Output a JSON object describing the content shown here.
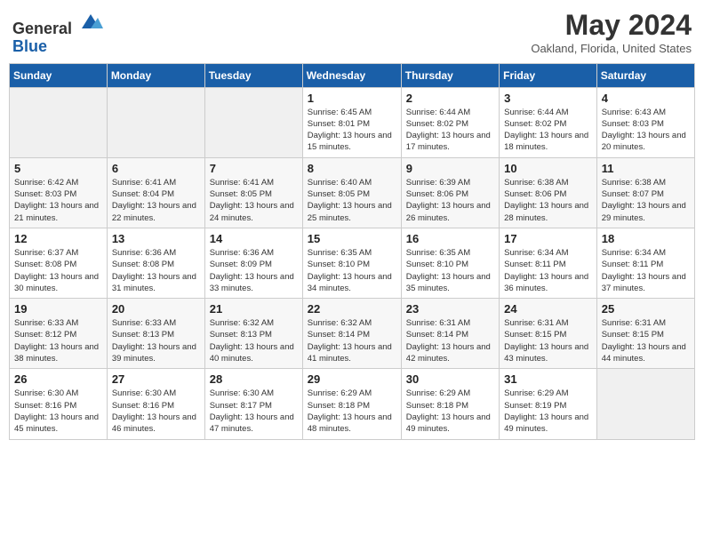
{
  "header": {
    "logo_line1": "General",
    "logo_line2": "Blue",
    "title": "May 2024",
    "location": "Oakland, Florida, United States"
  },
  "weekdays": [
    "Sunday",
    "Monday",
    "Tuesday",
    "Wednesday",
    "Thursday",
    "Friday",
    "Saturday"
  ],
  "weeks": [
    [
      {
        "day": "",
        "info": ""
      },
      {
        "day": "",
        "info": ""
      },
      {
        "day": "",
        "info": ""
      },
      {
        "day": "1",
        "info": "Sunrise: 6:45 AM\nSunset: 8:01 PM\nDaylight: 13 hours and 15 minutes."
      },
      {
        "day": "2",
        "info": "Sunrise: 6:44 AM\nSunset: 8:02 PM\nDaylight: 13 hours and 17 minutes."
      },
      {
        "day": "3",
        "info": "Sunrise: 6:44 AM\nSunset: 8:02 PM\nDaylight: 13 hours and 18 minutes."
      },
      {
        "day": "4",
        "info": "Sunrise: 6:43 AM\nSunset: 8:03 PM\nDaylight: 13 hours and 20 minutes."
      }
    ],
    [
      {
        "day": "5",
        "info": "Sunrise: 6:42 AM\nSunset: 8:03 PM\nDaylight: 13 hours and 21 minutes."
      },
      {
        "day": "6",
        "info": "Sunrise: 6:41 AM\nSunset: 8:04 PM\nDaylight: 13 hours and 22 minutes."
      },
      {
        "day": "7",
        "info": "Sunrise: 6:41 AM\nSunset: 8:05 PM\nDaylight: 13 hours and 24 minutes."
      },
      {
        "day": "8",
        "info": "Sunrise: 6:40 AM\nSunset: 8:05 PM\nDaylight: 13 hours and 25 minutes."
      },
      {
        "day": "9",
        "info": "Sunrise: 6:39 AM\nSunset: 8:06 PM\nDaylight: 13 hours and 26 minutes."
      },
      {
        "day": "10",
        "info": "Sunrise: 6:38 AM\nSunset: 8:06 PM\nDaylight: 13 hours and 28 minutes."
      },
      {
        "day": "11",
        "info": "Sunrise: 6:38 AM\nSunset: 8:07 PM\nDaylight: 13 hours and 29 minutes."
      }
    ],
    [
      {
        "day": "12",
        "info": "Sunrise: 6:37 AM\nSunset: 8:08 PM\nDaylight: 13 hours and 30 minutes."
      },
      {
        "day": "13",
        "info": "Sunrise: 6:36 AM\nSunset: 8:08 PM\nDaylight: 13 hours and 31 minutes."
      },
      {
        "day": "14",
        "info": "Sunrise: 6:36 AM\nSunset: 8:09 PM\nDaylight: 13 hours and 33 minutes."
      },
      {
        "day": "15",
        "info": "Sunrise: 6:35 AM\nSunset: 8:10 PM\nDaylight: 13 hours and 34 minutes."
      },
      {
        "day": "16",
        "info": "Sunrise: 6:35 AM\nSunset: 8:10 PM\nDaylight: 13 hours and 35 minutes."
      },
      {
        "day": "17",
        "info": "Sunrise: 6:34 AM\nSunset: 8:11 PM\nDaylight: 13 hours and 36 minutes."
      },
      {
        "day": "18",
        "info": "Sunrise: 6:34 AM\nSunset: 8:11 PM\nDaylight: 13 hours and 37 minutes."
      }
    ],
    [
      {
        "day": "19",
        "info": "Sunrise: 6:33 AM\nSunset: 8:12 PM\nDaylight: 13 hours and 38 minutes."
      },
      {
        "day": "20",
        "info": "Sunrise: 6:33 AM\nSunset: 8:13 PM\nDaylight: 13 hours and 39 minutes."
      },
      {
        "day": "21",
        "info": "Sunrise: 6:32 AM\nSunset: 8:13 PM\nDaylight: 13 hours and 40 minutes."
      },
      {
        "day": "22",
        "info": "Sunrise: 6:32 AM\nSunset: 8:14 PM\nDaylight: 13 hours and 41 minutes."
      },
      {
        "day": "23",
        "info": "Sunrise: 6:31 AM\nSunset: 8:14 PM\nDaylight: 13 hours and 42 minutes."
      },
      {
        "day": "24",
        "info": "Sunrise: 6:31 AM\nSunset: 8:15 PM\nDaylight: 13 hours and 43 minutes."
      },
      {
        "day": "25",
        "info": "Sunrise: 6:31 AM\nSunset: 8:15 PM\nDaylight: 13 hours and 44 minutes."
      }
    ],
    [
      {
        "day": "26",
        "info": "Sunrise: 6:30 AM\nSunset: 8:16 PM\nDaylight: 13 hours and 45 minutes."
      },
      {
        "day": "27",
        "info": "Sunrise: 6:30 AM\nSunset: 8:16 PM\nDaylight: 13 hours and 46 minutes."
      },
      {
        "day": "28",
        "info": "Sunrise: 6:30 AM\nSunset: 8:17 PM\nDaylight: 13 hours and 47 minutes."
      },
      {
        "day": "29",
        "info": "Sunrise: 6:29 AM\nSunset: 8:18 PM\nDaylight: 13 hours and 48 minutes."
      },
      {
        "day": "30",
        "info": "Sunrise: 6:29 AM\nSunset: 8:18 PM\nDaylight: 13 hours and 49 minutes."
      },
      {
        "day": "31",
        "info": "Sunrise: 6:29 AM\nSunset: 8:19 PM\nDaylight: 13 hours and 49 minutes."
      },
      {
        "day": "",
        "info": ""
      }
    ]
  ]
}
